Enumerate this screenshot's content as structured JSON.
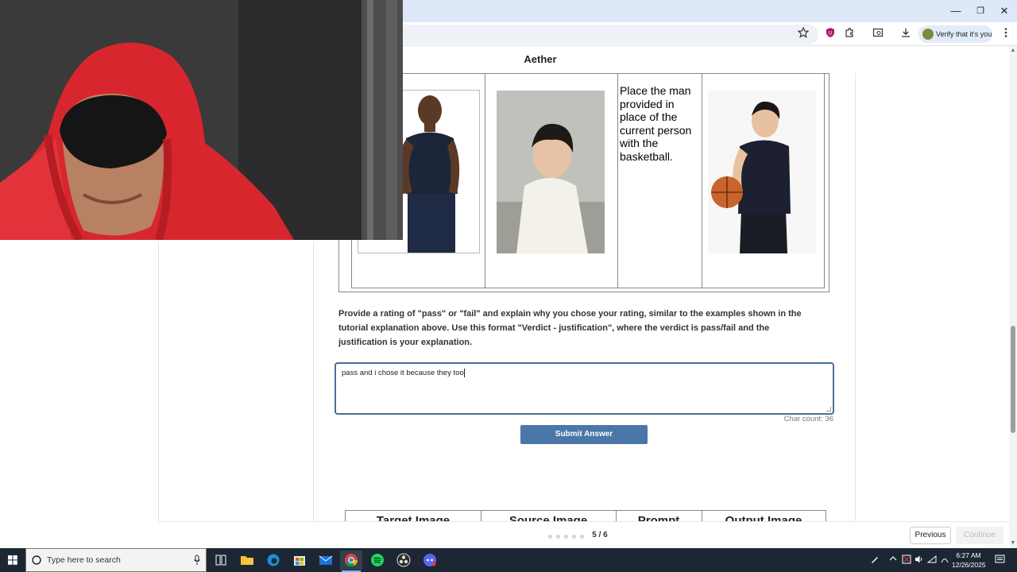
{
  "browser": {
    "profile_chip": "Verify that it's you",
    "window_controls": {
      "minimize": "—",
      "restore": "❐",
      "close": "✕"
    }
  },
  "page": {
    "site_title": "Aether",
    "example": {
      "prompt": "Place the man provided in place of the current person with the basketball."
    },
    "question": "Provide a rating of \"pass\" or \"fail\" and explain why you chose your rating, similar to the examples shown in the tutorial explanation above. Use this format \"Verdict - justification\", where the verdict is pass/fail and the justification is your explanation.",
    "answer_value": "pass and i chose it because they too",
    "char_count": "Char count: 36",
    "submit_label": "Submit Answer",
    "next_table_headers": [
      "Target Image",
      "Source Image",
      "Prompt",
      "Output Image"
    ],
    "pagination": {
      "indicator": "5 / 6",
      "current": 5,
      "total": 6
    },
    "previous_label": "Previous",
    "continue_label": "Continue"
  },
  "taskbar": {
    "search_placeholder": "Type here to search",
    "time": "6:27 AM",
    "date": "12/26/2025"
  },
  "colors": {
    "accent": "#4a77a8",
    "answer_border": "#4a6e96",
    "taskbar": "#1c2733",
    "titlebar": "#dfe8f9"
  }
}
